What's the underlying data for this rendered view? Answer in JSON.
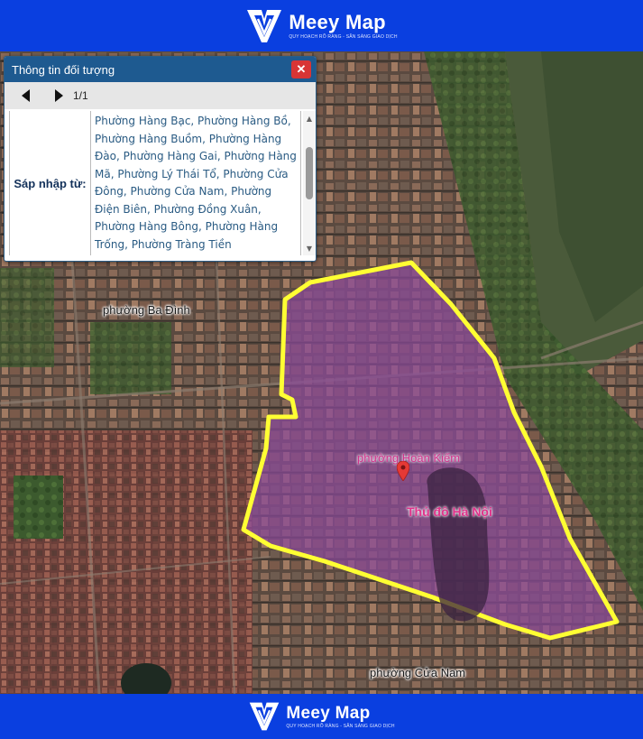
{
  "brand": {
    "name": "Meey Map",
    "tagline": "QUY HOẠCH RÕ RÀNG - SẴN SÀNG GIAO DỊCH",
    "color": "#0a3fe0"
  },
  "popup": {
    "title": "Thông tin đối tượng",
    "close_icon": "close-icon",
    "pagination": "1/1",
    "field_label": "Sáp nhập từ:",
    "field_value": "Phường Hàng Bạc, Phường Hàng Bồ, Phường Hàng Buồm, Phường Hàng Đào, Phường Hàng Gai, Phường Hàng Mã, Phường Lý Thái Tổ, Phường Cửa Đông, Phường Cửa Nam, Phường Điện Biên, Phường Đồng Xuân, Phường Hàng Bông, Phường Hàng Trống, Phường Tràng Tiền"
  },
  "map": {
    "labels": {
      "ba_dinh": "phường Ba Đình",
      "hoan_kiem": "phường Hoàn Kiếm",
      "cua_nam": "phường Cửa Nam",
      "capital": "Thủ đô Hà Nội"
    },
    "highlight_fill": "#8a4a9a",
    "highlight_outline": "#ffff33",
    "marker_color": "#e53935"
  }
}
